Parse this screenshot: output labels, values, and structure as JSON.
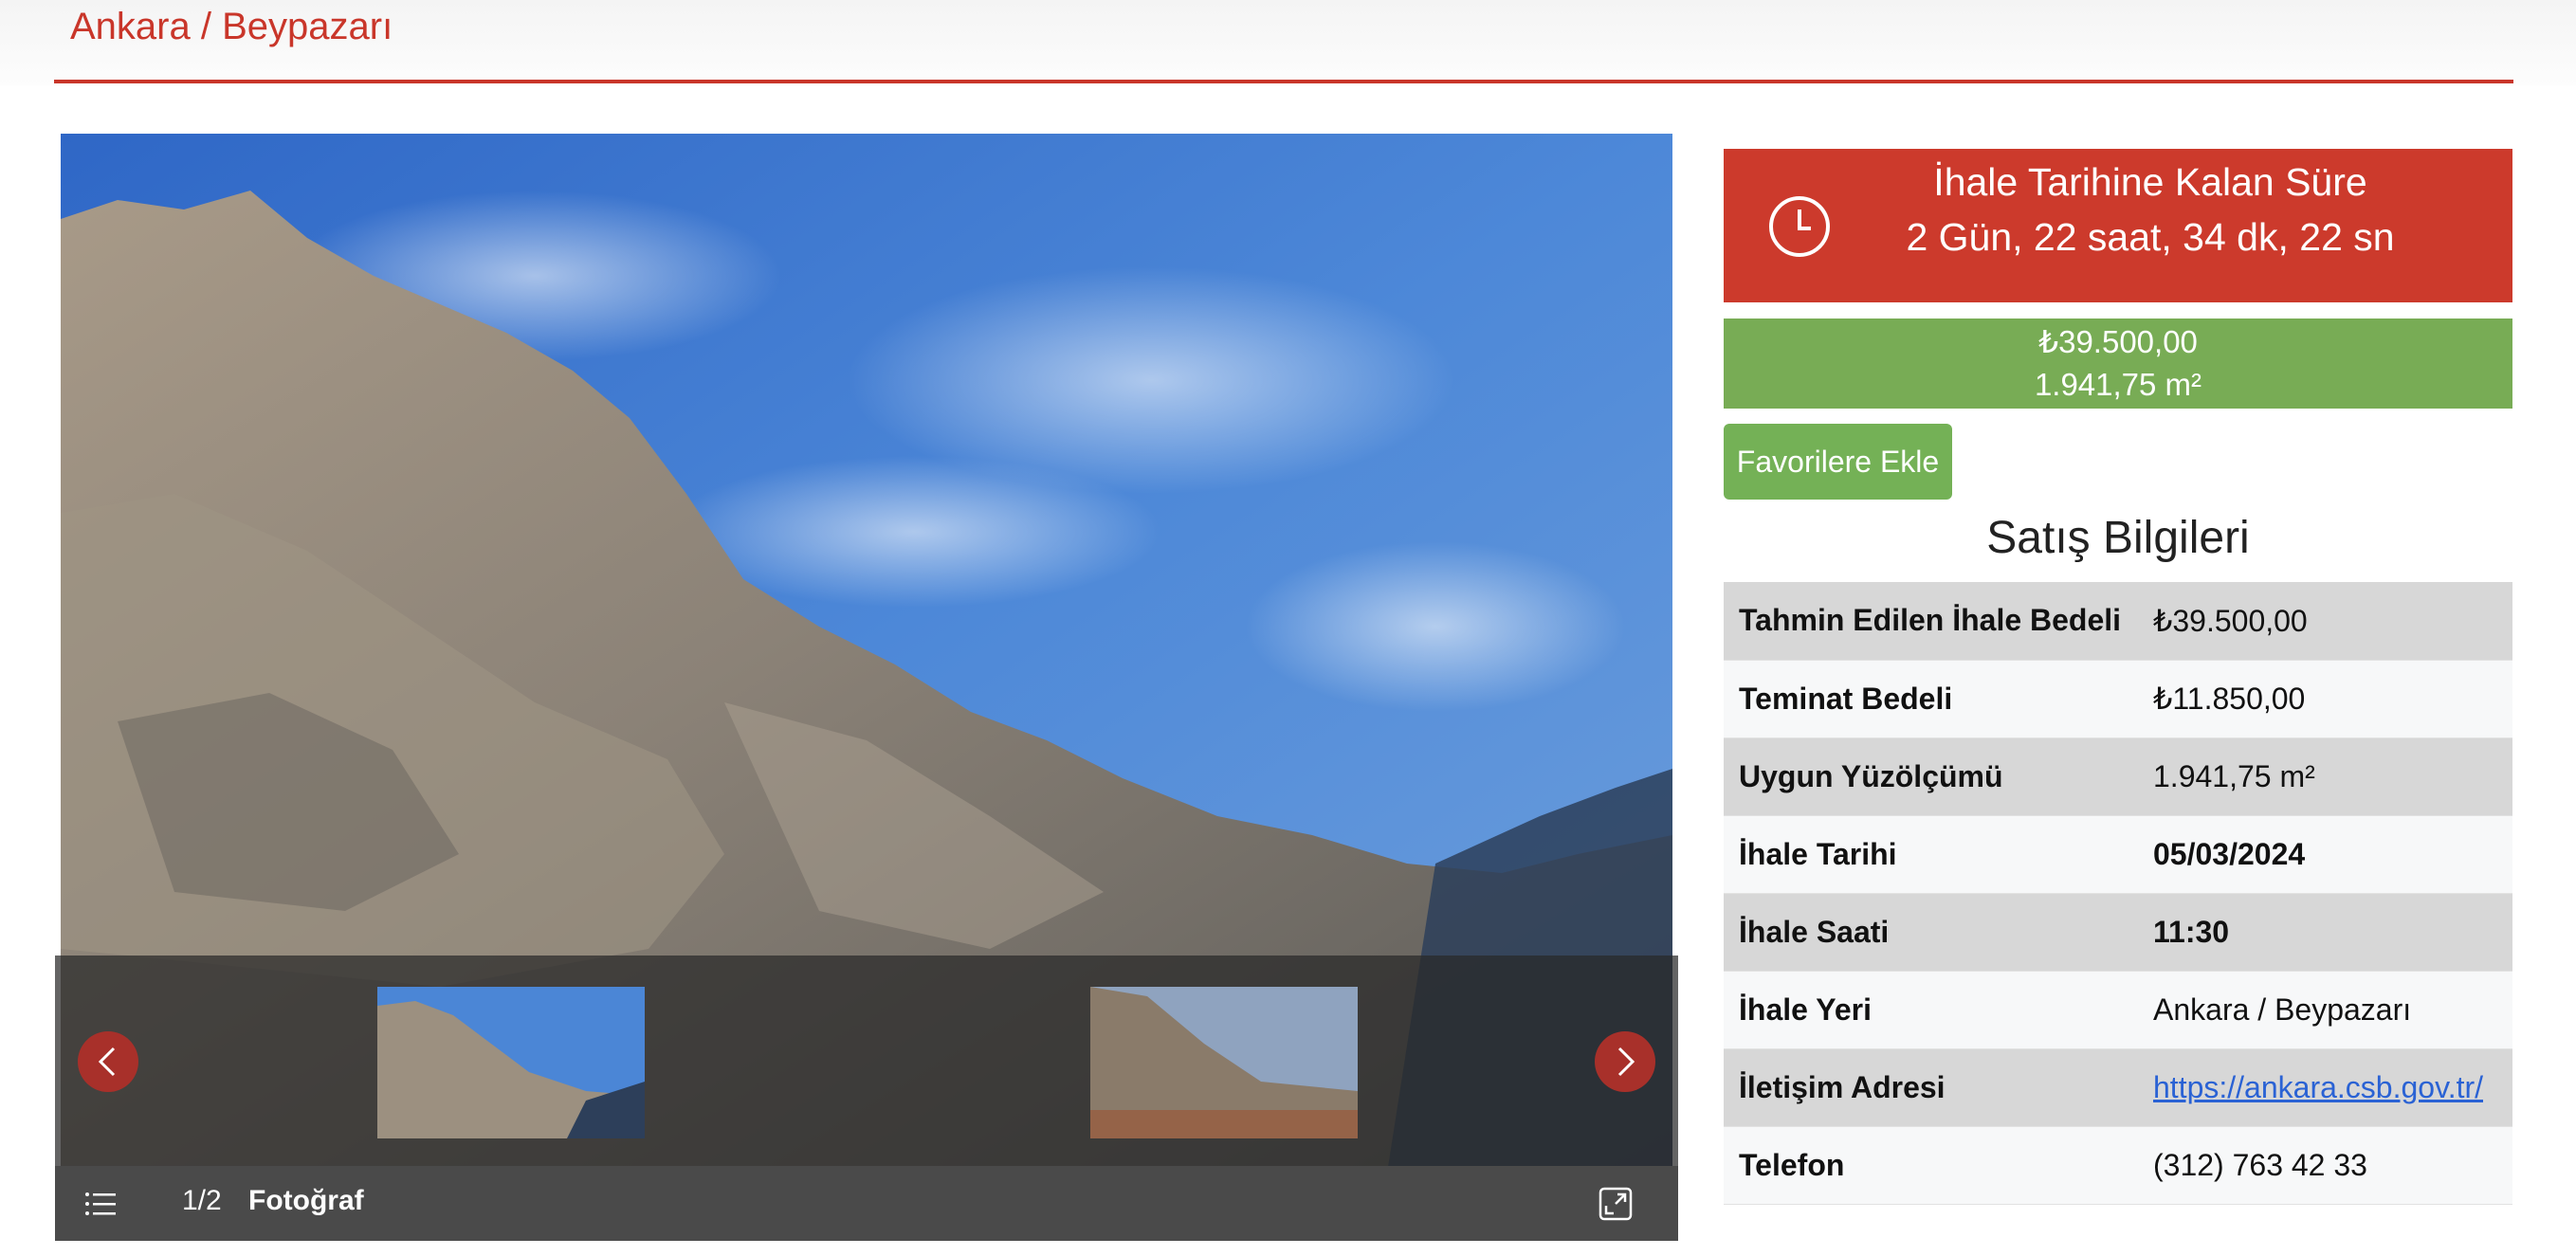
{
  "header": {
    "title": "Ankara / Beypazarı"
  },
  "gallery": {
    "counter": "1/2",
    "label": "Fotoğraf",
    "icons": {
      "prev": "chevron-left-icon",
      "next": "chevron-right-icon",
      "list": "list-icon",
      "expand": "expand-icon"
    }
  },
  "timer": {
    "title": "İhale Tarihine Kalan Süre",
    "value": "2 Gün, 22 saat, 34 dk, 22 sn",
    "icon": "clock-icon"
  },
  "price": {
    "amount": "₺39.500,00",
    "area": "1.941,75 m²"
  },
  "favorite_label": "Favorilere Ekle",
  "sales": {
    "title": "Satış Bilgileri",
    "rows": [
      {
        "label": "Tahmin Edilen İhale Bedeli",
        "value": "₺39.500,00"
      },
      {
        "label": "Teminat Bedeli",
        "value": "₺11.850,00"
      },
      {
        "label": "Uygun Yüzölçümü",
        "value": "1.941,75 m²"
      },
      {
        "label": "İhale Tarihi",
        "value": "05/03/2024"
      },
      {
        "label": "İhale Saati",
        "value": "11:30"
      },
      {
        "label": "İhale Yeri",
        "value": "Ankara / Beypazarı"
      },
      {
        "label": "İletişim Adresi",
        "value": "https://ankara.csb.gov.tr/"
      },
      {
        "label": "Telefon",
        "value": "(312) 763 42 33"
      }
    ]
  },
  "colors": {
    "brand_red": "#c9362a",
    "timer_red": "#cc3a2c",
    "price_green": "#78ac55",
    "button_green": "#74b156",
    "link_blue": "#2a62d4"
  }
}
